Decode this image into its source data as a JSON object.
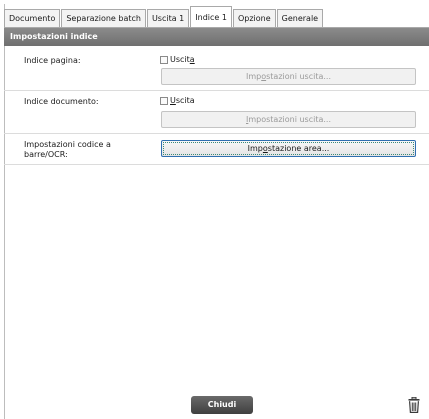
{
  "tabs": [
    {
      "label": "Documento",
      "active": false
    },
    {
      "label": "Separazione batch",
      "active": false
    },
    {
      "label": "Uscita 1",
      "active": false
    },
    {
      "label": "Indice 1",
      "active": true
    },
    {
      "label": "Opzione",
      "active": false
    },
    {
      "label": "Generale",
      "active": false
    }
  ],
  "section": {
    "title": "Impostazioni indice"
  },
  "rows": {
    "page_index": {
      "label": "Indice pagina:",
      "checkbox_pre": "Uscit",
      "checkbox_ul": "a",
      "checkbox_post": "",
      "button_pre": "Imp",
      "button_ul": "o",
      "button_post": "stazioni uscita..."
    },
    "doc_index": {
      "label": "Indice documento:",
      "checkbox_pre": "",
      "checkbox_ul": "U",
      "checkbox_post": "scita",
      "button_pre": "",
      "button_ul": "I",
      "button_post": "mpostazioni uscita..."
    },
    "barcode": {
      "label_line1": "Impostazioni codice a",
      "label_line2": "barre/OCR:",
      "button_pre": "Imp",
      "button_ul": "o",
      "button_post": "stazione area..."
    }
  },
  "footer": {
    "close_label": "Chiudi"
  },
  "icons": {
    "delete": "trash-icon"
  }
}
